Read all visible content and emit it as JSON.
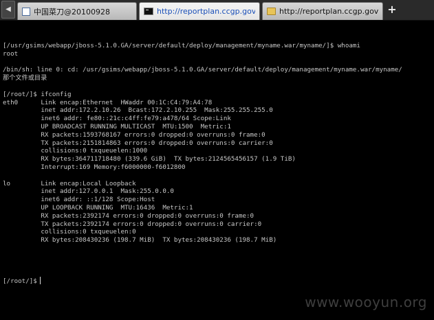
{
  "tabs": [
    {
      "label": "中国菜刀@20100928",
      "icon": "page-icon",
      "active": false
    },
    {
      "label": "http://reportplan.ccgp.gov.cn...",
      "icon": "terminal-icon",
      "active": true
    },
    {
      "label": "http://reportplan.ccgp.gov.cn...",
      "icon": "folder-icon",
      "active": false
    }
  ],
  "new_tab_label": "+",
  "terminal": {
    "lines": [
      "[/usr/gsims/webapp/jboss-5.1.0.GA/server/default/deploy/management/myname.war/myname/]$ whoami",
      "root",
      "",
      "/bin/sh: line 0: cd: /usr/gsims/webapp/jboss-5.1.0.GA/server/default/deploy/management/myname.war/myname/",
      "那个文件或目录",
      "",
      "[/root/]$ ifconfig",
      "eth0      Link encap:Ethernet  HWaddr 00:1C:C4:79:A4:78",
      "          inet addr:172.2.10.26  Bcast:172.2.10.255  Mask:255.255.255.0",
      "          inet6 addr: fe80::21c:c4ff:fe79:a478/64 Scope:Link",
      "          UP BROADCAST RUNNING MULTICAST  MTU:1500  Metric:1",
      "          RX packets:1593768167 errors:0 dropped:0 overruns:0 frame:0",
      "          TX packets:2151814863 errors:0 dropped:0 overruns:0 carrier:0",
      "          collisions:0 txqueuelen:1000",
      "          RX bytes:364711718480 (339.6 GiB)  TX bytes:2124565456157 (1.9 TiB)",
      "          Interrupt:169 Memory:f6000000-f6012800",
      "",
      "lo        Link encap:Local Loopback",
      "          inet addr:127.0.0.1  Mask:255.0.0.0",
      "          inet6 addr: ::1/128 Scope:Host",
      "          UP LOOPBACK RUNNING  MTU:16436  Metric:1",
      "          RX packets:2392174 errors:0 dropped:0 overruns:0 frame:0",
      "          TX packets:2392174 errors:0 dropped:0 overruns:0 carrier:0",
      "          collisions:0 txqueuelen:0",
      "          RX bytes:208430236 (198.7 MiB)  TX bytes:208430236 (198.7 MiB)",
      "",
      "",
      "",
      ""
    ],
    "prompt": "[/root/]$"
  },
  "watermark": "www.wooyun.org"
}
